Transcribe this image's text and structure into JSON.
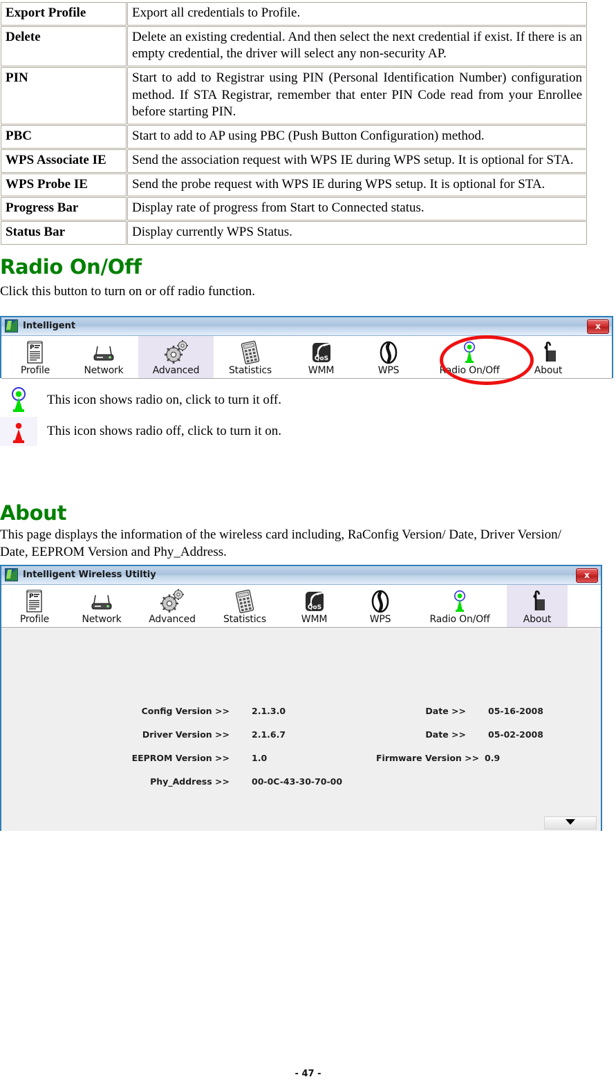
{
  "doc": {
    "footer": "- 47 -"
  },
  "wps_table": {
    "rows": [
      {
        "term": "Export Profile",
        "desc": "Export all credentials to Profile."
      },
      {
        "term": "Delete",
        "desc": "Delete an existing credential. And then select the next credential if exist. If there is an empty credential, the driver will select any non-security AP."
      },
      {
        "term": "PIN",
        "desc": "Start to add to Registrar using PIN (Personal Identification Number) configuration method. If STA Registrar, remember that enter PIN Code read from your Enrollee before starting PIN."
      },
      {
        "term": "PBC",
        "desc": "Start to add to AP using PBC (Push Button Configuration) method."
      },
      {
        "term": "WPS Associate IE",
        "desc": "Send the association request with WPS IE during WPS setup. It is optional for STA."
      },
      {
        "term": "WPS Probe IE",
        "desc": "Send the probe request with WPS IE during WPS setup. It is optional for STA."
      },
      {
        "term": "Progress Bar",
        "desc": "Display rate of progress from Start to Connected status."
      },
      {
        "term": "Status Bar",
        "desc": "Display currently WPS Status."
      }
    ]
  },
  "radio_section": {
    "heading": "Radio On/Off",
    "intro": "Click this button to turn on or off radio function.",
    "window": {
      "title": "Intelligent",
      "close_label": "x",
      "active_tab": "Advanced",
      "highlighted_tab": "Radio On/Off",
      "tabs": [
        {
          "label": "Profile",
          "icon": "profile-icon"
        },
        {
          "label": "Network",
          "icon": "network-router-icon"
        },
        {
          "label": "Advanced",
          "icon": "gears-icon"
        },
        {
          "label": "Statistics",
          "icon": "calculator-icon"
        },
        {
          "label": "WMM",
          "icon": "qos-signal-icon"
        },
        {
          "label": "WPS",
          "icon": "wps-arrows-icon"
        },
        {
          "label": "Radio On/Off",
          "icon": "radio-tower-on-icon"
        },
        {
          "label": "About",
          "icon": "about-info-icon"
        }
      ]
    },
    "legend": [
      {
        "icon": "radio-tower-on-icon",
        "text": "This icon shows radio on, click to turn it off."
      },
      {
        "icon": "radio-tower-off-icon",
        "text": "This icon shows radio off, click to turn it on."
      }
    ]
  },
  "about_section": {
    "heading": "About",
    "intro": "This page displays the information of the wireless card including, RaConfig Version/ Date, Driver Version/ Date, EEPROM Version and Phy_Address.",
    "window": {
      "title": "Intelligent Wireless Utiltiy",
      "close_label": "x",
      "active_tab": "About",
      "tabs": [
        {
          "label": "Profile",
          "icon": "profile-icon"
        },
        {
          "label": "Network",
          "icon": "network-router-icon"
        },
        {
          "label": "Advanced",
          "icon": "gears-icon"
        },
        {
          "label": "Statistics",
          "icon": "calculator-icon"
        },
        {
          "label": "WMM",
          "icon": "qos-signal-icon"
        },
        {
          "label": "WPS",
          "icon": "wps-arrows-icon"
        },
        {
          "label": "Radio On/Off",
          "icon": "radio-tower-on-icon"
        },
        {
          "label": "About",
          "icon": "about-info-icon"
        }
      ],
      "info": {
        "config_version_label": "Config Version >>",
        "config_version_value": "2.1.3.0",
        "config_date_label": "Date >>",
        "config_date_value": "05-16-2008",
        "driver_version_label": "Driver Version >>",
        "driver_version_value": "2.1.6.7",
        "driver_date_label": "Date >>",
        "driver_date_value": "05-02-2008",
        "eeprom_version_label": "EEPROM Version >>",
        "eeprom_version_value": "1.0",
        "firmware_version_label": "Firmware Version >>",
        "firmware_version_value": "0.9",
        "phy_address_label": "Phy_Address >>",
        "phy_address_value": "00-0C-43-30-70-00"
      },
      "expand_icon": "chevron-down-icon"
    }
  },
  "colors": {
    "heading_green": "#008000",
    "window_border_blue": "#2f7fb8",
    "active_tab_lavender": "#e8e4f2",
    "highlight_ring_red": "#ee1111",
    "radio_on_green": "#00dd00",
    "radio_off_red": "#ee1111"
  }
}
